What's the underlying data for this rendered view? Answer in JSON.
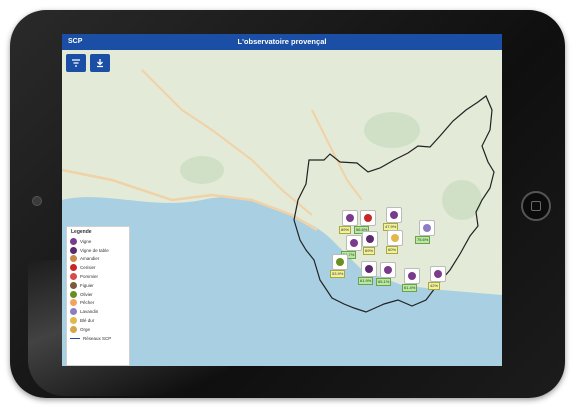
{
  "app": {
    "title": "L'observatoire provençal",
    "logo_text": "SCP"
  },
  "toolbar": {
    "filter_icon": "filter-icon",
    "download_icon": "download-icon"
  },
  "legend": {
    "title": "Legende",
    "items": [
      {
        "label": "Vigne",
        "color": "#7b3b8b"
      },
      {
        "label": "Vigne de table",
        "color": "#5b2a6e"
      },
      {
        "label": "Amandier",
        "color": "#c88a4a"
      },
      {
        "label": "Cerisier",
        "color": "#c62828"
      },
      {
        "label": "Pommier",
        "color": "#d94a4a"
      },
      {
        "label": "Figuier",
        "color": "#7a5a3a"
      },
      {
        "label": "Olivier",
        "color": "#6b8e23"
      },
      {
        "label": "Pêcher",
        "color": "#f4a261"
      },
      {
        "label": "Lavandin",
        "color": "#8e7cc3"
      },
      {
        "label": "Blé dur",
        "color": "#e0b84d"
      },
      {
        "label": "Orge",
        "color": "#d4a84a"
      },
      {
        "label": "Réseaux SCP",
        "color": "#1b4fa5"
      }
    ]
  },
  "markers": [
    {
      "label": "89%",
      "green": false
    },
    {
      "label": "56.6%",
      "green": true
    },
    {
      "label": "47.9%",
      "green": false
    },
    {
      "label": "75.6%",
      "green": true
    },
    {
      "label": "69%",
      "green": false
    },
    {
      "label": "60%",
      "green": false
    },
    {
      "label": "54.7%",
      "green": true
    },
    {
      "label": "65.1%",
      "green": true
    },
    {
      "label": "61.9%",
      "green": true
    },
    {
      "label": "42%",
      "green": false
    },
    {
      "label": "53.9%",
      "green": false
    },
    {
      "label": "61.4%",
      "green": true
    }
  ],
  "colors": {
    "appbar": "#1b4fa5",
    "land": "#dfe8d9",
    "sea": "#a9cfe3",
    "border": "#222222"
  }
}
